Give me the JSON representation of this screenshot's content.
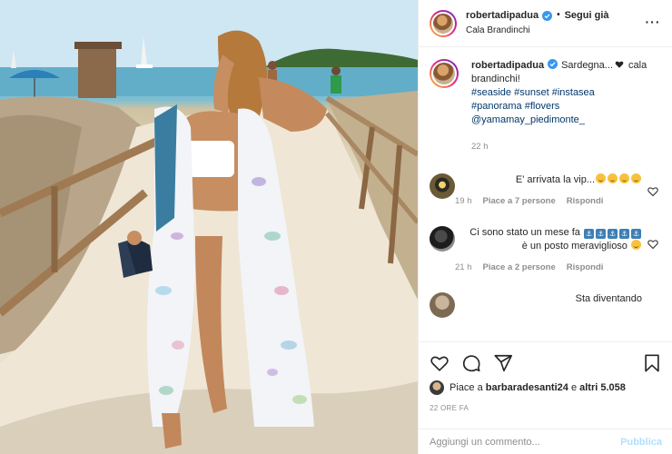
{
  "header": {
    "username": "robertadipadua",
    "follow_label": "Segui già",
    "location": "Cala Brandinchi",
    "more_label": "···"
  },
  "caption": {
    "username": "robertadipadua",
    "text_main": "Sardegna...",
    "text_tail": "cala brandinchi!",
    "hashtags": [
      "#seaside",
      "#sunset",
      "#instasea",
      "#panorama",
      "#flovers"
    ],
    "mention": "@yamamay_piedimonte_",
    "time": "22 h"
  },
  "comments": [
    {
      "text": "E' arrivata la vip...",
      "emoji_count": 4,
      "time": "19 h",
      "likes": "Piace a 7 persone",
      "reply": "Rispondi"
    },
    {
      "text_before": "Ci sono stato un mese fa",
      "text_after": "è un posto meraviglioso",
      "anchor_count": 5,
      "time": "21 h",
      "likes": "Piace a 2 persone",
      "reply": "Rispondi"
    },
    {
      "text": "Sta diventando"
    }
  ],
  "actions": {
    "likes_prefix": "Piace a",
    "likes_user": "barbaradesanti24",
    "likes_middle": "e",
    "likes_others": "altri 5.058",
    "ago": "22 ORE FA"
  },
  "add_comment": {
    "placeholder": "Aggiungi un commento...",
    "publish_label": "Pubblica"
  },
  "colors": {
    "link": "#00376b",
    "verified": "#3897f0",
    "publish_disabled": "#b2dffc",
    "meta_gray": "#8e8e8e"
  },
  "icons": [
    "verified-icon",
    "more-icon",
    "heart-icon",
    "comment-icon",
    "share-icon",
    "bookmark-icon"
  ]
}
